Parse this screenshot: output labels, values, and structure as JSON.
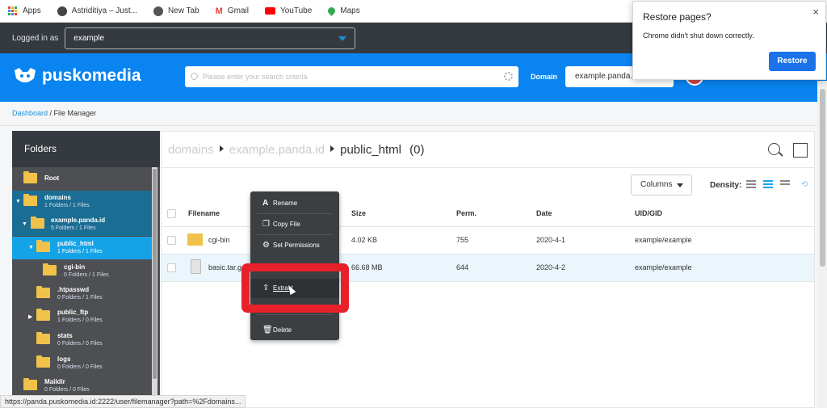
{
  "bookmarks": [
    {
      "label": "Apps",
      "icon": "apps-grid-icon"
    },
    {
      "label": "Astriditiya – Just...",
      "icon": "site-icon"
    },
    {
      "label": "New Tab",
      "icon": "globe-icon"
    },
    {
      "label": "Gmail",
      "icon": "gmail-icon"
    },
    {
      "label": "YouTube",
      "icon": "youtube-icon"
    },
    {
      "label": "Maps",
      "icon": "maps-icon"
    }
  ],
  "login": {
    "label": "Logged in as",
    "value": "example"
  },
  "header": {
    "brand": "puskomedia",
    "search_placeholder": "Please enter your search criteria",
    "domain_label": "Domain",
    "domain_value": "example.panda.id"
  },
  "restore_popup": {
    "title": "Restore pages?",
    "message": "Chrome didn't shut down correctly.",
    "button": "Restore",
    "close": "×"
  },
  "breadcrumb": {
    "link": "Dashboard",
    "separator": " / ",
    "current": "File Manager"
  },
  "folders": {
    "title": "Folders",
    "items": [
      {
        "name": "Root",
        "meta": ""
      },
      {
        "name": "domains",
        "meta": "1 Folders / 1 Files"
      },
      {
        "name": "example.panda.id",
        "meta": "5 Folders / 1 Files"
      },
      {
        "name": "public_html",
        "meta": "1 Folders / 1 Files"
      },
      {
        "name": "cgi-bin",
        "meta": "0 Folders / 1 Files"
      },
      {
        "name": ".htpasswd",
        "meta": "0 Folders / 1 Files"
      },
      {
        "name": "public_ftp",
        "meta": "1 Folders / 0 Files"
      },
      {
        "name": "stats",
        "meta": "0 Folders / 0 Files"
      },
      {
        "name": "logs",
        "meta": "0 Folders / 0 Files"
      },
      {
        "name": "Maildir",
        "meta": "0 Folders / 0 Files"
      }
    ]
  },
  "path": {
    "seg1": "domains",
    "seg2": "example.panda.id",
    "current": "public_html",
    "count": "(0)"
  },
  "toolbar": {
    "columns": "Columns",
    "density": "Density:"
  },
  "table": {
    "headers": {
      "filename": "Filename",
      "size": "Size",
      "perm": "Perm.",
      "date": "Date",
      "uid": "UID/GID"
    },
    "rows": [
      {
        "name": "cgi-bin",
        "size": "4.02 KB",
        "perm": "755",
        "date": "2020-4-1",
        "uid": "example/example",
        "type": "folder"
      },
      {
        "name": "basic.tar.g",
        "size": "66.68 MB",
        "perm": "644",
        "date": "2020-4-2",
        "uid": "example/example",
        "type": "archive"
      }
    ]
  },
  "context_menu": {
    "items": [
      {
        "label": "Rename",
        "icon": "rename-icon"
      },
      {
        "label": "Copy File",
        "icon": "copy-icon"
      },
      {
        "label": "Set Permissions",
        "icon": "permissions-icon"
      },
      {
        "label": "Extract",
        "icon": "extract-icon"
      },
      {
        "label": "Delete",
        "icon": "trash-icon"
      }
    ]
  },
  "status_url": "https://panda.puskomedia.id:2222/user/filemanager?path=%2Fdomains..."
}
